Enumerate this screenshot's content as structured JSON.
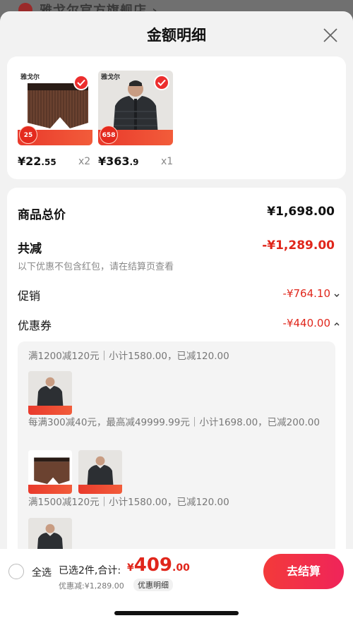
{
  "background": {
    "store_name": "雅戈尔官方旗舰店 ›"
  },
  "sheet": {
    "title": "金额明细"
  },
  "products": [
    {
      "price_int": "¥22",
      "price_dec": ".55",
      "qty": "x2",
      "badge": "25"
    },
    {
      "price_int": "¥363",
      "price_dec": ".9",
      "qty": "x1",
      "badge": "658"
    }
  ],
  "summary": {
    "total_label": "商品总价",
    "total_value": "¥1,698.00",
    "discount_label": "共减",
    "discount_value": "-¥1,289.00",
    "note": "以下优惠不包含红包，请在结算页查看",
    "promo_label": "促销",
    "promo_value": "-¥764.10",
    "coupon_label": "优惠券",
    "coupon_value": "-¥440.00"
  },
  "coupons": [
    {
      "rule": "满1200减120元｜小计1580.00，已减120.00"
    },
    {
      "rule": "每满300减40元，最高减49999.99元｜小计1698.00，已减200.00"
    },
    {
      "rule": "满1500减120元｜小计1580.00，已减120.00"
    }
  ],
  "bottom": {
    "select_all": "全选",
    "selected_text": "已选2件,合计:",
    "currency": "¥",
    "total_int": "409",
    "total_dec": ".00",
    "discount_text": "优惠减:¥1,289.00",
    "detail_chip": "优惠明细",
    "checkout": "去结算"
  },
  "colors": {
    "accent_red": "#e0261b",
    "checkout_gradient_start": "#f33a3a",
    "checkout_gradient_end": "#f0245a"
  }
}
